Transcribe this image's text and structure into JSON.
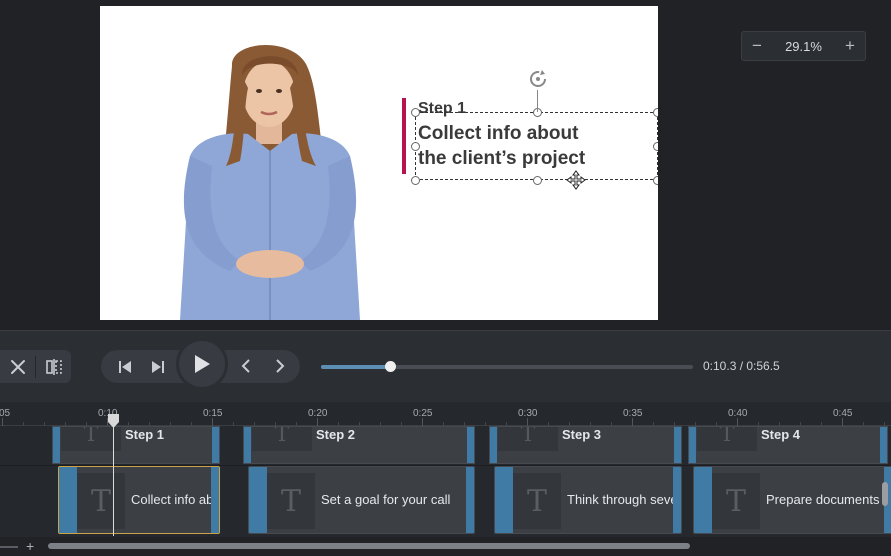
{
  "canvas": {
    "zoom": {
      "minus_label": "−",
      "value": "29.1%",
      "plus_label": "+"
    },
    "slide": {
      "step_label": "Step 1",
      "heading_line1": "Collect info about",
      "heading_line2": "the client’s project",
      "accent_color": "#b8134f"
    }
  },
  "transport": {
    "tools": [
      {
        "name": "cut-icon"
      },
      {
        "name": "split-icon"
      }
    ],
    "buttons": [
      "previous-marker",
      "next-marker",
      "play",
      "step-back",
      "step-forward"
    ],
    "progress_fraction": 0.186,
    "time_readout": "0:10.3 / 0:56.5"
  },
  "timeline": {
    "ruler_labels": [
      "05",
      "0:10",
      "0:15",
      "0:20",
      "0:25",
      "0:30",
      "0:35",
      "0:40",
      "0:45"
    ],
    "track1_clips": [
      {
        "label": "Step 1",
        "thumb_glyph": "T"
      },
      {
        "label": "Step 2",
        "thumb_glyph": "T"
      },
      {
        "label": "Step 3",
        "thumb_glyph": "T"
      },
      {
        "label": "Step 4",
        "thumb_glyph": "T"
      }
    ],
    "track2_clips": [
      {
        "label": "Collect info about",
        "thumb_glyph": "T",
        "selected": true
      },
      {
        "label": "Set a goal for your call",
        "thumb_glyph": "T",
        "selected": false
      },
      {
        "label": "Think through several",
        "thumb_glyph": "T",
        "selected": false
      },
      {
        "label": "Prepare documents",
        "thumb_glyph": "T",
        "selected": false
      }
    ],
    "add_track_label": "+",
    "clip_edge_color": "#3f7ba5",
    "selected_clip_border": "#c9a24a"
  }
}
